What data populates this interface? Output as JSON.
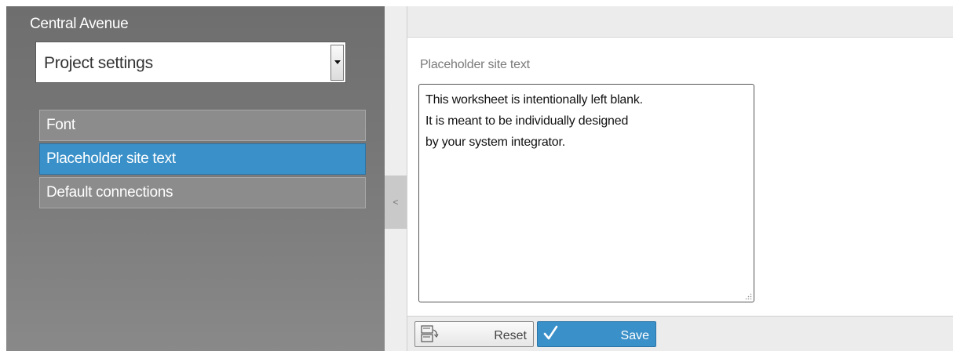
{
  "sidebar": {
    "app_title": "Central Avenue",
    "project_select": {
      "selected": "Project settings"
    },
    "items": [
      {
        "label": "Font",
        "active": false
      },
      {
        "label": "Placeholder site text",
        "active": true
      },
      {
        "label": "Default connections",
        "active": false
      }
    ],
    "collapse_glyph": "<"
  },
  "main": {
    "section_label": "Placeholder site text",
    "textarea_lines": [
      "This worksheet is intentionally left blank.",
      "It is meant to be individually designed",
      "by your system integrator."
    ]
  },
  "footer": {
    "reset_label": "Reset",
    "save_label": "Save"
  },
  "colors": {
    "accent": "#3a90c8",
    "sidebar_bg": "#777777"
  },
  "icons": {
    "dropdown": "chevron-down-icon",
    "collapse": "chevron-left-icon",
    "reset": "reset-icon",
    "save": "check-icon",
    "resize": "resize-grip-icon"
  }
}
